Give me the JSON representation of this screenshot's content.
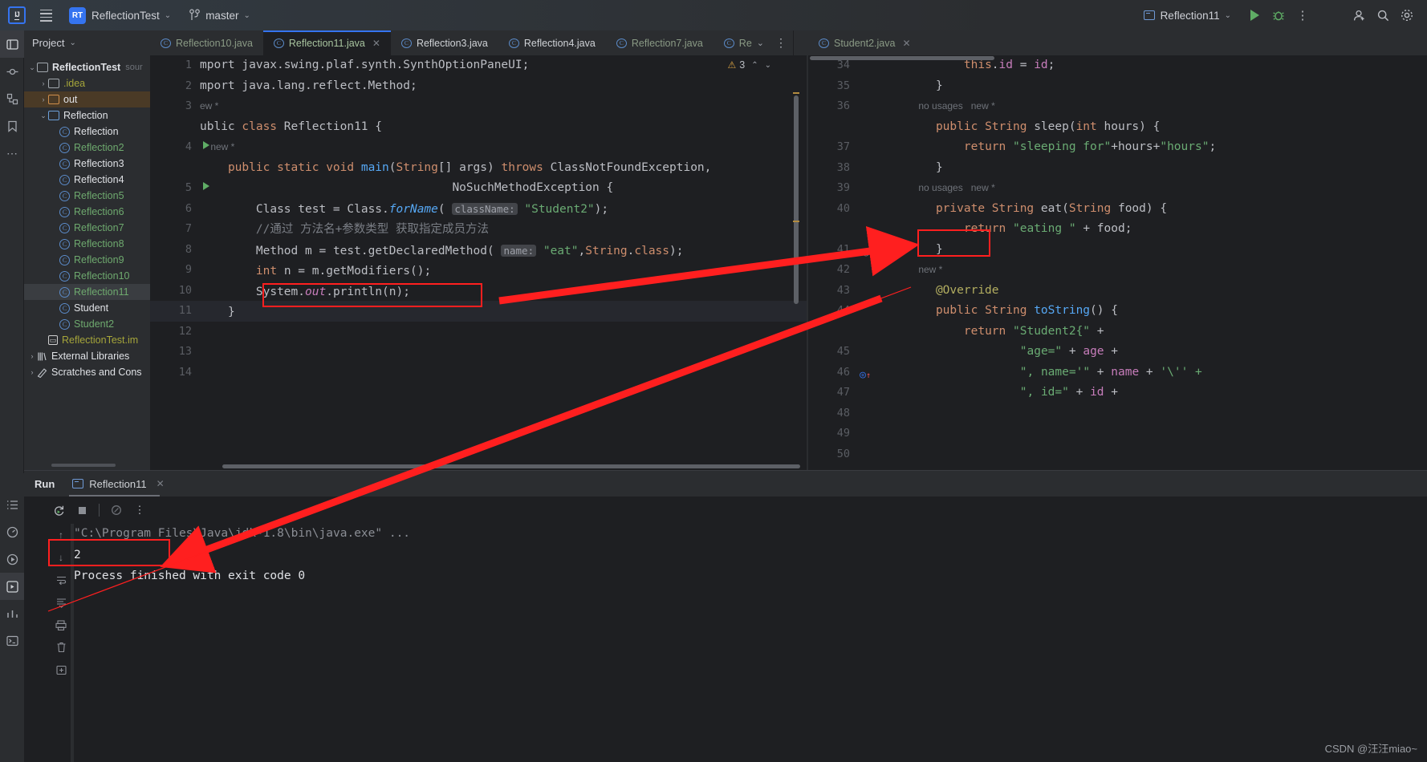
{
  "toolbar": {
    "logo": "IJ",
    "menu_icon": "hamburger-icon",
    "project_badge": "RT",
    "project_name": "ReflectionTest",
    "branch_icon": "git-branch-icon",
    "branch_name": "master",
    "run_config": "Reflection11",
    "run_icon": "run-icon",
    "debug_icon": "debug-icon",
    "more_icon": "more-vertical-icon",
    "account_icon": "account-icon",
    "search_icon": "search-icon",
    "settings_icon": "settings-icon"
  },
  "project_panel": {
    "title": "Project",
    "tree": [
      {
        "label": "ReflectionTest",
        "suffix": "sour",
        "icon": "module-folder-icon",
        "indent": 0,
        "arrow": "expanded",
        "color": "white",
        "bold": true
      },
      {
        "label": ".idea",
        "icon": "folder-icon",
        "indent": 1,
        "arrow": "collapsed",
        "color": "olive"
      },
      {
        "label": "out",
        "icon": "folder-orange-icon",
        "indent": 1,
        "arrow": "collapsed",
        "color": "white",
        "highlight": true
      },
      {
        "label": "Reflection",
        "icon": "folder-blue-icon",
        "indent": 1,
        "arrow": "expanded",
        "color": "white"
      },
      {
        "label": "Reflection",
        "icon": "java-class-icon",
        "indent": 2,
        "color": "white"
      },
      {
        "label": "Reflection2",
        "icon": "java-class-icon",
        "indent": 2,
        "color": "green"
      },
      {
        "label": "Reflection3",
        "icon": "java-class-icon",
        "indent": 2,
        "color": "white"
      },
      {
        "label": "Reflection4",
        "icon": "java-class-icon",
        "indent": 2,
        "color": "white"
      },
      {
        "label": "Reflection5",
        "icon": "java-class-icon",
        "indent": 2,
        "color": "green"
      },
      {
        "label": "Reflection6",
        "icon": "java-class-icon",
        "indent": 2,
        "color": "green"
      },
      {
        "label": "Reflection7",
        "icon": "java-class-icon",
        "indent": 2,
        "color": "green"
      },
      {
        "label": "Reflection8",
        "icon": "java-class-icon",
        "indent": 2,
        "color": "green"
      },
      {
        "label": "Reflection9",
        "icon": "java-class-icon",
        "indent": 2,
        "color": "green"
      },
      {
        "label": "Reflection10",
        "icon": "java-class-icon",
        "indent": 2,
        "color": "green"
      },
      {
        "label": "Reflection11",
        "icon": "java-class-icon",
        "indent": 2,
        "color": "green",
        "selected": true
      },
      {
        "label": "Student",
        "icon": "java-class-icon",
        "indent": 2,
        "color": "white"
      },
      {
        "label": "Student2",
        "icon": "java-class-icon",
        "indent": 2,
        "color": "green"
      },
      {
        "label": "ReflectionTest.im",
        "icon": "iml-file-icon",
        "indent": 1,
        "color": "olive"
      },
      {
        "label": "External Libraries",
        "icon": "library-icon",
        "indent": 0,
        "arrow": "collapsed",
        "color": "white"
      },
      {
        "label": "Scratches and Cons",
        "icon": "scratches-icon",
        "indent": 0,
        "arrow": "collapsed",
        "color": "white"
      }
    ]
  },
  "editor": {
    "tabs": [
      {
        "label": "Reflection10.java",
        "color": "green",
        "active": false
      },
      {
        "label": "Reflection11.java",
        "color": "green",
        "active": true,
        "closable": true
      },
      {
        "label": "Reflection3.java",
        "color": "white",
        "active": false
      },
      {
        "label": "Reflection4.java",
        "color": "white",
        "active": false
      },
      {
        "label": "Reflection7.java",
        "color": "green",
        "active": false
      },
      {
        "label": "Re",
        "color": "green",
        "active": false,
        "truncated": true
      }
    ],
    "tab_overflow_icon": "chevron-down-icon",
    "tab_options_icon": "more-vertical-icon",
    "right_tab": {
      "label": "Student2.java",
      "color": "green",
      "closable": true
    },
    "warning_badge": {
      "icon": "warning-triangle-icon",
      "count": "3",
      "up_icon": "chevron-up-icon",
      "down_icon": "chevron-down-icon"
    }
  },
  "left_code": {
    "file": "Reflection11.java",
    "lines": [
      {
        "num": "1",
        "text": "mport javax.swing.plaf.synth.SynthOptionPaneUI;"
      },
      {
        "num": "2",
        "text": "mport java.lang.reflect.Method;"
      },
      {
        "num": "3",
        "text": ""
      },
      {
        "num": "",
        "text": "ew *",
        "inlay": true
      },
      {
        "num": "4",
        "text": "ublic class Reflection11 {",
        "runmark": true
      },
      {
        "num": "",
        "text": "    new *",
        "inlay": true
      },
      {
        "num": "5",
        "text": "    public static void main(String[] args) throws ClassNotFoundException,",
        "runmark": true
      },
      {
        "num": "6",
        "text": "                                    NoSuchMethodException {"
      },
      {
        "num": "7",
        "text": "        Class test = Class.forName( className: \"Student2\");"
      },
      {
        "num": "8",
        "text": "        //通过 方法名+参数类型 获取指定成员方法"
      },
      {
        "num": "9",
        "text": "        Method m = test.getDeclaredMethod( name: \"eat\",String.class);"
      },
      {
        "num": "10",
        "text": "        int n = m.getModifiers();"
      },
      {
        "num": "11",
        "text": "        System.out.println(n);"
      },
      {
        "num": "12",
        "text": "    }"
      },
      {
        "num": "13",
        "text": ""
      },
      {
        "num": "14",
        "text": ""
      }
    ]
  },
  "right_code": {
    "file": "Student2.java",
    "lines": [
      {
        "num": "34",
        "text": "        this.id = id;"
      },
      {
        "num": "35",
        "text": "    }"
      },
      {
        "num": "36",
        "text": ""
      },
      {
        "num": "",
        "text": "    no usages   new *",
        "inlay": true
      },
      {
        "num": "37",
        "text": "    public String sleep(int hours) {"
      },
      {
        "num": "38",
        "text": "        return \"sleeping for\"+hours+\"hours\";"
      },
      {
        "num": "39",
        "text": "    }"
      },
      {
        "num": "40",
        "text": ""
      },
      {
        "num": "",
        "text": "    no usages   new *",
        "inlay": true
      },
      {
        "num": "41",
        "text": "    private String eat(String food) {"
      },
      {
        "num": "42",
        "text": "        return \"eating \" + food;"
      },
      {
        "num": "43",
        "text": "    }"
      },
      {
        "num": "44",
        "text": ""
      },
      {
        "num": "",
        "text": "    new *",
        "inlay": true
      },
      {
        "num": "45",
        "text": "    @Override"
      },
      {
        "num": "46",
        "text": "    public String toString() {"
      },
      {
        "num": "47",
        "text": "        return \"Student2{\" +"
      },
      {
        "num": "48",
        "text": "                \"age=\" + age +"
      },
      {
        "num": "49",
        "text": "                \", name='\" + name + '\\'' +"
      },
      {
        "num": "50",
        "text": "                \", id=\" + id +"
      }
    ]
  },
  "run_panel": {
    "title": "Run",
    "tab_label": "Reflection11",
    "tab_icon": "run-config-icon",
    "close_icon": "close-icon",
    "toolbar_icons": [
      "rerun-icon",
      "stop-icon",
      "print-icon",
      "more-vertical-icon"
    ],
    "side_icons": [
      "scroll-up-icon",
      "scroll-down-icon",
      "soft-wrap-icon",
      "scroll-to-end-icon",
      "print-icon",
      "trash-icon",
      "export-icon"
    ],
    "console": [
      {
        "text": "\"C:\\Program Files\\Java\\jdk-1.8\\bin\\java.exe\" ...",
        "style": "dim"
      },
      {
        "text": "2",
        "style": "white"
      },
      {
        "text": "",
        "style": "white"
      },
      {
        "text": "Process finished with exit code 0",
        "style": "white"
      }
    ]
  },
  "annotations": {
    "box_code_getmodifiers": "int n = m.getModifiers();",
    "box_code_private": "private",
    "box_output_value": "2",
    "arrow_color": "#ff1f1f"
  },
  "watermark": "CSDN @汪汪miao~"
}
